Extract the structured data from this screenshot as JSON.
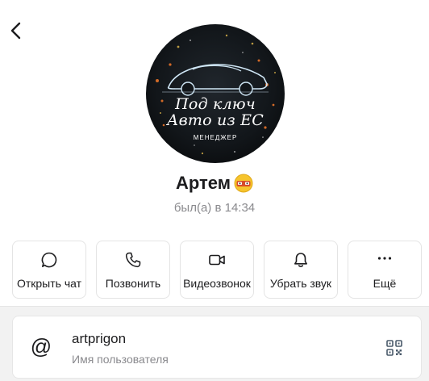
{
  "header": {
    "back_icon": "chevron-left-icon"
  },
  "profile": {
    "avatar_lines": [
      "Под ключ",
      "Авто из ЕС",
      "МЕНЕДЖЕР"
    ],
    "name": "Артем",
    "status_emoji": "car-face-emoji",
    "last_seen": "был(а) в 14:34"
  },
  "actions": [
    {
      "label": "Открыть чат",
      "icon": "chat-bubble-icon"
    },
    {
      "label": "Позвонить",
      "icon": "phone-icon"
    },
    {
      "label": "Видеозвонок",
      "icon": "video-camera-icon"
    },
    {
      "label": "Убрать звук",
      "icon": "bell-icon"
    },
    {
      "label": "Ещё",
      "icon": "more-dots-icon"
    }
  ],
  "info": {
    "username": "artprigon",
    "username_caption": "Имя пользователя",
    "at_symbol": "@",
    "qr_icon": "qr-code-icon"
  },
  "colors": {
    "secondary_text": "#8a8a8e",
    "border": "#e4e4e4",
    "panel_bg": "#f2f2f2"
  }
}
